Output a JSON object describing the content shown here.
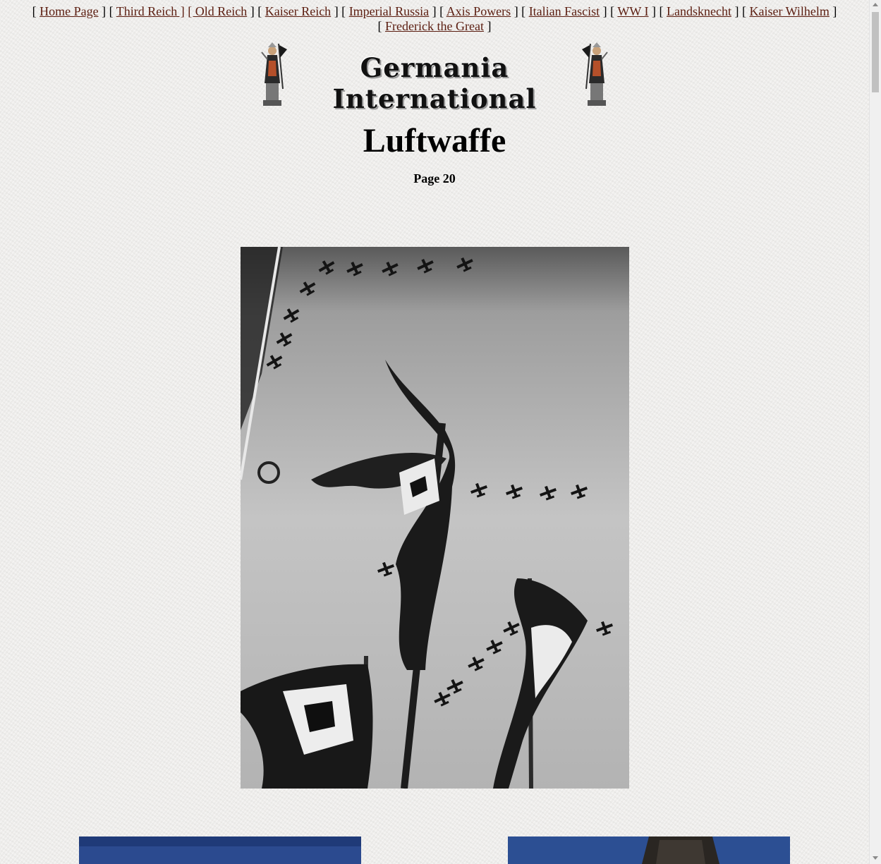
{
  "nav": {
    "home": "Home Page",
    "third_reich": "Third Reich ]",
    "old_reich": "[ Old Reich",
    "kaiser_reich": "Kaiser Reich",
    "imperial_russia": "Imperial Russia",
    "axis_powers": "Axis Powers",
    "italian_fascist": "Italian Fascist",
    "ww1": "WW I",
    "landsknecht": "Landsknecht",
    "kaiser_wilhelm": "Kaiser Wilhelm",
    "frederick": "Frederick the Great"
  },
  "banner": {
    "title": "Germania International",
    "icon_left": "germania-statue-icon",
    "icon_right": "germania-statue-icon"
  },
  "title": "Luftwaffe",
  "subtitle": "Page 20",
  "colors": {
    "link": "#5b1d10",
    "background": "#efeeec",
    "photo_sky_blue": "#2b4a8f"
  }
}
